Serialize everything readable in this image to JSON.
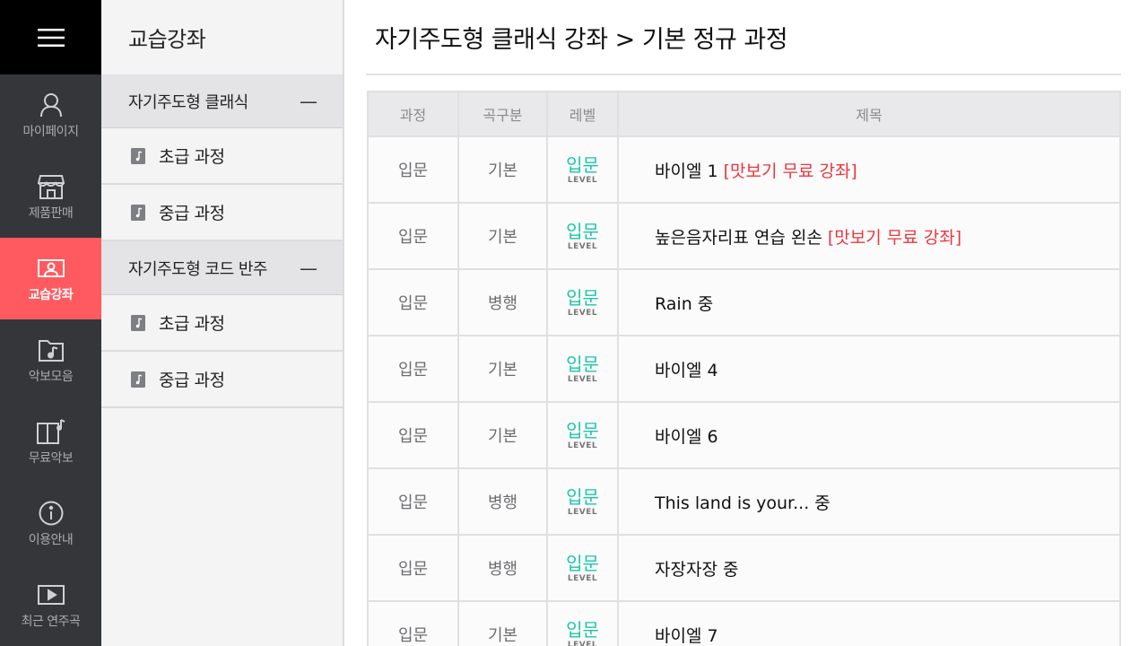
{
  "rail": {
    "items": [
      {
        "label": "마이페이지",
        "icon": "user-icon",
        "active": false
      },
      {
        "label": "제품판매",
        "icon": "store-icon",
        "active": false
      },
      {
        "label": "교습강좌",
        "icon": "lecture-icon",
        "active": true
      },
      {
        "label": "악보모음",
        "icon": "music-folder-icon",
        "active": false
      },
      {
        "label": "무료악보",
        "icon": "free-sheet-icon",
        "active": false
      },
      {
        "label": "이용안내",
        "icon": "info-icon",
        "active": false
      },
      {
        "label": "최근 연주곡",
        "icon": "play-icon",
        "active": false
      }
    ]
  },
  "sidebar": {
    "title": "교습강좌",
    "groups": [
      {
        "label": "자기주도형 클래식",
        "toggle": "—",
        "items": [
          {
            "label": "초급 과정"
          },
          {
            "label": "중급 과정"
          }
        ]
      },
      {
        "label": "자기주도형 코드 반주",
        "toggle": "—",
        "items": [
          {
            "label": "초급 과정"
          },
          {
            "label": "중급 과정"
          }
        ]
      }
    ]
  },
  "main": {
    "title": "자기주도형 클래식 강좌 > 기본 정규 과정",
    "table": {
      "headers": [
        "과정",
        "곡구분",
        "레벨",
        "제목"
      ],
      "rows": [
        {
          "course": "입문",
          "type": "기본",
          "level": "입문",
          "level_sub": "LEVEL",
          "title": "바이엘 1",
          "tag": "[맛보기 무료 강좌]"
        },
        {
          "course": "입문",
          "type": "기본",
          "level": "입문",
          "level_sub": "LEVEL",
          "title": "높은음자리표 연습 왼손",
          "tag": "[맛보기 무료 강좌]"
        },
        {
          "course": "입문",
          "type": "병행",
          "level": "입문",
          "level_sub": "LEVEL",
          "title": "Rain 중",
          "tag": ""
        },
        {
          "course": "입문",
          "type": "기본",
          "level": "입문",
          "level_sub": "LEVEL",
          "title": "바이엘 4",
          "tag": ""
        },
        {
          "course": "입문",
          "type": "기본",
          "level": "입문",
          "level_sub": "LEVEL",
          "title": "바이엘 6",
          "tag": ""
        },
        {
          "course": "입문",
          "type": "병행",
          "level": "입문",
          "level_sub": "LEVEL",
          "title": "This land is your... 중",
          "tag": ""
        },
        {
          "course": "입문",
          "type": "병행",
          "level": "입문",
          "level_sub": "LEVEL",
          "title": "자장자장 중",
          "tag": ""
        },
        {
          "course": "입문",
          "type": "기본",
          "level": "입문",
          "level_sub": "LEVEL",
          "title": "바이엘 7",
          "tag": ""
        }
      ]
    }
  },
  "colors": {
    "accent": "#ff5a5f",
    "level": "#1cc6a8",
    "free_tag": "#e8373d",
    "rail_bg": "#34363a"
  }
}
